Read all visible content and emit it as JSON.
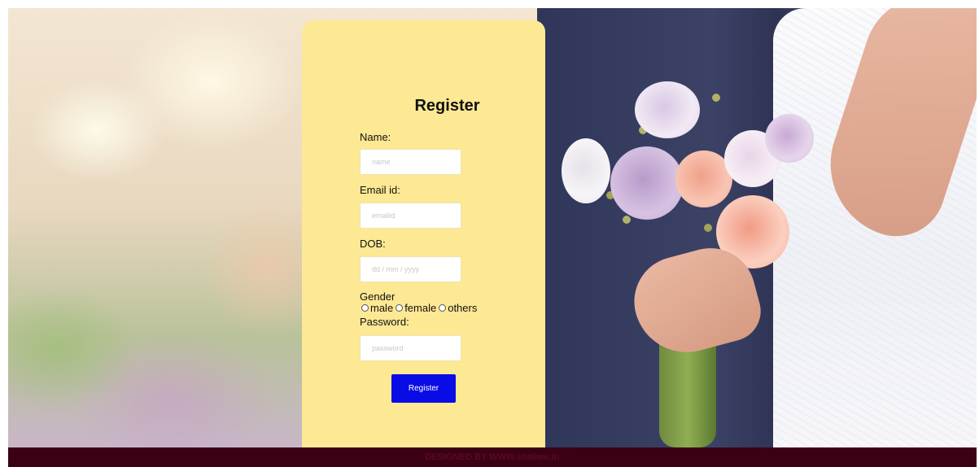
{
  "form": {
    "title": "Register",
    "name_label": "Name:",
    "name_placeholder": "name",
    "email_label": "Email id:",
    "email_placeholder": "emailid",
    "dob_label": "DOB:",
    "dob_placeholder": "dd / mm / yyyy",
    "gender_label": "Gender",
    "gender_options": [
      "male",
      "female",
      "others"
    ],
    "password_label": "Password:",
    "password_placeholder": "password",
    "submit_label": "Register"
  },
  "footer": {
    "text": "DESIGNED BY WWW.shaliwe.in"
  },
  "colors": {
    "card": "#fde894",
    "button": "#0a0ce6",
    "footer": "#3b0014"
  }
}
